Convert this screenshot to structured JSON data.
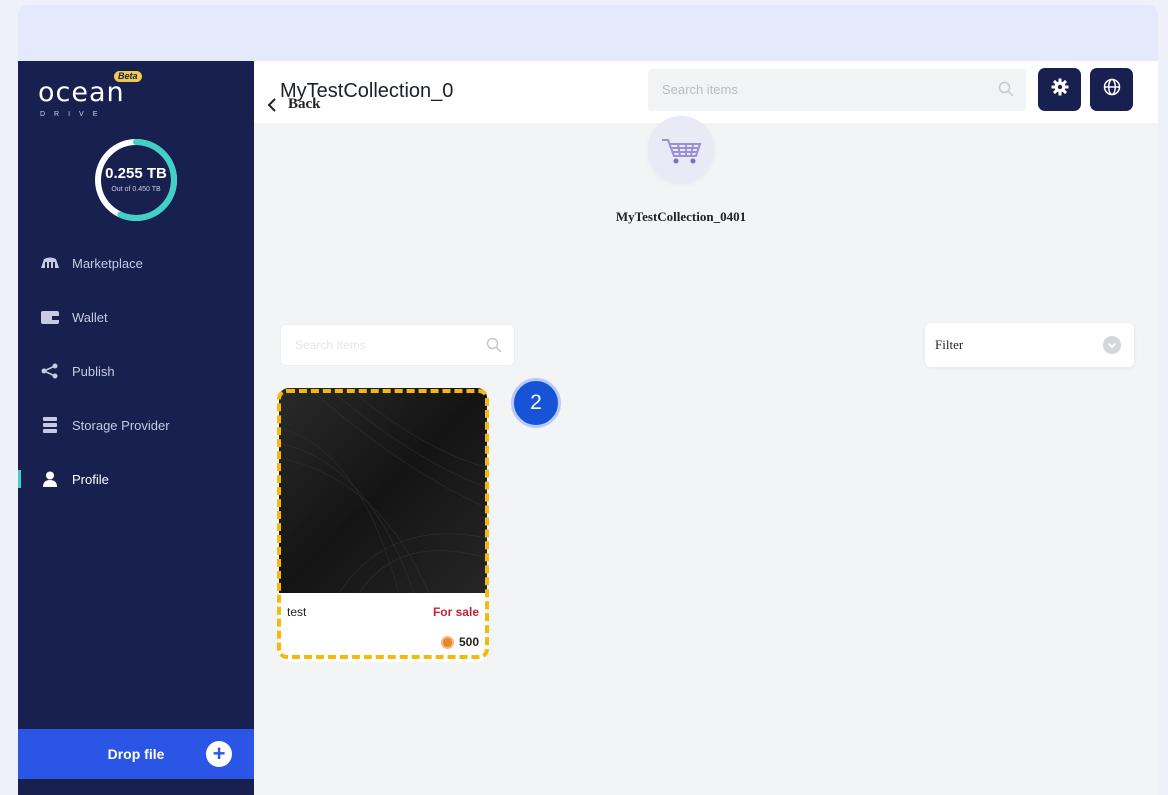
{
  "app": {
    "logo_word": "ocean",
    "logo_badge": "Beta",
    "logo_sub": "DRIVE"
  },
  "storage": {
    "used": "0.255 TB",
    "total_text": "Out of 0.450 TB",
    "fraction_used": 0.567
  },
  "sidebar": {
    "items": [
      {
        "label": "Marketplace",
        "icon": "marketplace-icon"
      },
      {
        "label": "Wallet",
        "icon": "wallet-icon"
      },
      {
        "label": "Publish",
        "icon": "share-icon"
      },
      {
        "label": "Storage Provider",
        "icon": "server-icon"
      },
      {
        "label": "Profile",
        "icon": "user-icon",
        "active": true
      }
    ],
    "drop_label": "Drop file"
  },
  "header": {
    "title": "MyTestCollection_0",
    "search_placeholder": "Search items"
  },
  "content": {
    "back_label": "Back",
    "collection_name": "MyTestCollection_0401",
    "item_search_placeholder": "Search Items",
    "filter_label": "Filter"
  },
  "items": [
    {
      "name": "test",
      "status": "For sale",
      "price": "500"
    }
  ],
  "annotation": {
    "step_number": "2"
  },
  "colors": {
    "sidebar_bg": "#17204f",
    "accent": "#2a55e5",
    "ring": "#3fd0c6",
    "sale": "#c0243a",
    "highlight": "#f4b90b"
  }
}
